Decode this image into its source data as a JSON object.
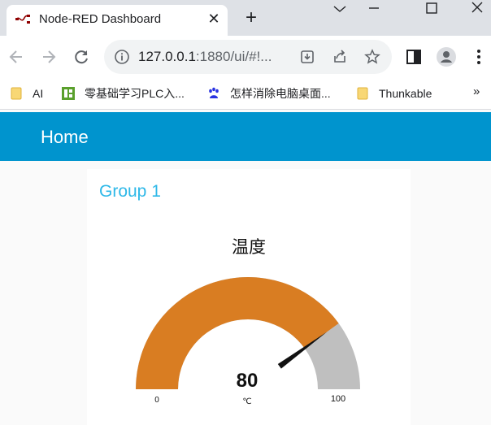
{
  "browser": {
    "tab": {
      "title": "Node-RED Dashboard",
      "close_glyph": "✕",
      "icon": "node-red-icon"
    },
    "new_tab_glyph": "+",
    "address": {
      "host": "127.0.0.1",
      "rest": ":1880/ui/#!..."
    },
    "bookmarks": [
      {
        "label": "AI",
        "icon": "folder-icon"
      },
      {
        "label": "零基础学习PLC入...",
        "icon": "site-favicon"
      },
      {
        "label": "怎样消除电脑桌面...",
        "icon": "baidu-icon"
      },
      {
        "label": "Thunkable",
        "icon": "folder-icon"
      }
    ],
    "bookmarks_more": "»"
  },
  "dashboard": {
    "header_title": "Home",
    "group_title": "Group 1",
    "gauge": {
      "title": "温度",
      "value": "80",
      "value_num": 80,
      "unit": "℃",
      "min": "0",
      "max": "100",
      "fill_color": "#d97d22",
      "rest_color": "#bfbfbf",
      "needle_color": "#111111"
    }
  }
}
